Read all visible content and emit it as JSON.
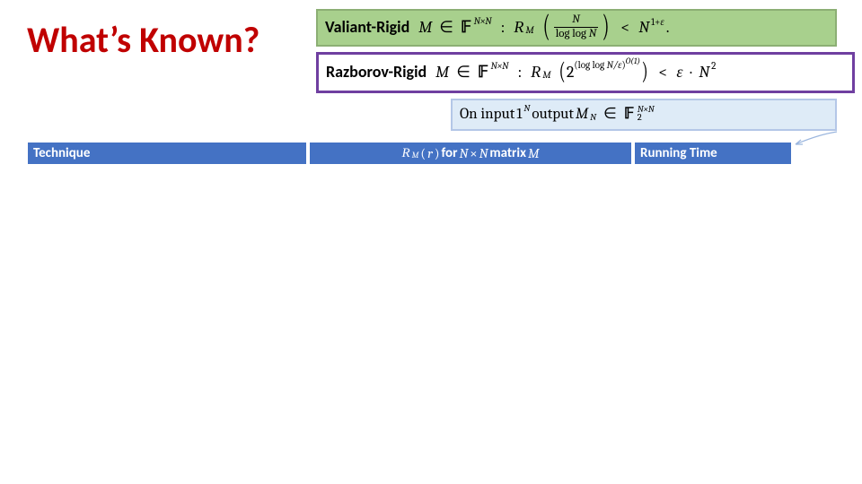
{
  "title": "What’s Known?",
  "boxes": {
    "valiant": {
      "label": "Valiant-Rigid",
      "M": "M",
      "in": "∈",
      "field": "𝔽",
      "Nexp": "N×N",
      "colon": ":",
      "R": "R",
      "Rsub": "M",
      "frac_num": "N",
      "frac_den_a": "log log ",
      "frac_den_b": "N",
      "lt": "<",
      "rhs_N": "N",
      "rhs_exp_a": "1+",
      "rhs_exp_b": "ε",
      "dot": "."
    },
    "razborov": {
      "label": "Razborov-Rigid",
      "M": "M",
      "in": "∈",
      "field": "𝔽",
      "Nexp": "N×N",
      "colon": ":",
      "R": "R",
      "Rsub": "M",
      "two": "2",
      "exp_a": "(log log ",
      "exp_b": "N/ε",
      "exp_c": ")",
      "exp_sup": "O(1)",
      "lt": "<",
      "eps": "ε",
      "cdot": "·",
      "N": "N",
      "sq": "2"
    },
    "input": {
      "a": "On input ",
      "one": "1",
      "oneexp": "N",
      "b": " output ",
      "M": "M",
      "Msub": "N",
      "in": "∈",
      "field": "𝔽",
      "fsub": "2",
      "fsup": "N×N"
    }
  },
  "headers": {
    "technique": "Technique",
    "rm": {
      "R": "R",
      "Rsub": "M",
      "lp": "(",
      "r": "r",
      "rp": ")",
      "for": " for ",
      "N": "N",
      "times": " × ",
      "matrix": " matrix ",
      "M2": "M"
    },
    "time": "Running Time"
  }
}
